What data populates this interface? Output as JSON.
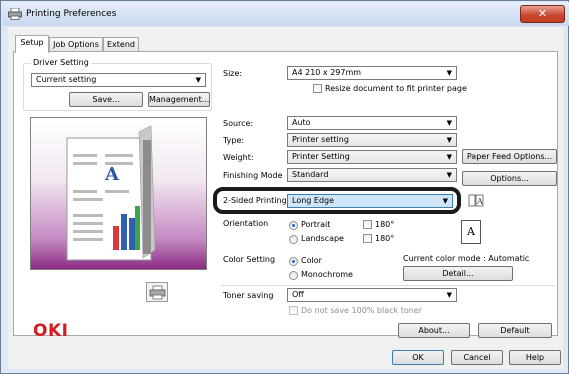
{
  "window": {
    "title": "Printing Preferences",
    "close_symbol": "✕"
  },
  "tabs": [
    {
      "label": "Setup",
      "active": true
    },
    {
      "label": "Job Options",
      "active": false
    },
    {
      "label": "Extend",
      "active": false
    }
  ],
  "driver_setting": {
    "group_label": "Driver Setting",
    "value": "Current setting",
    "save_label": "Save...",
    "management_label": "Management..."
  },
  "paper": {
    "size_label": "Size:",
    "size_value": "A4 210 x 297mm",
    "resize_label": "Resize document to fit printer page",
    "source_label": "Source:",
    "source_value": "Auto",
    "type_label": "Type:",
    "type_value": "Printer setting",
    "weight_label": "Weight:",
    "weight_value": "Printer Setting",
    "paper_feed_label": "Paper Feed Options...",
    "finishing_label": "Finishing Mode",
    "finishing_value": "Standard",
    "options_label": "Options..."
  },
  "two_sided": {
    "label": "2-Sided Printing",
    "value": "Long Edge"
  },
  "orientation": {
    "label": "Orientation",
    "portrait": "Portrait",
    "landscape": "Landscape",
    "rotate1": "180°",
    "rotate2": "180°",
    "selected": "portrait",
    "page_glyph": "A"
  },
  "color": {
    "label": "Color Setting",
    "color_option": "Color",
    "mono_option": "Monochrome",
    "mode_text": "Current color mode : Automatic",
    "detail_label": "Detail..."
  },
  "toner": {
    "label": "Toner saving",
    "value": "Off",
    "no_save_label": "Do not save 100% black toner"
  },
  "preview": {
    "page_glyph": "A"
  },
  "brand": {
    "logo": "OKI",
    "color": "#d11d1d"
  },
  "footer": {
    "about_label": "About...",
    "default_label": "Default",
    "ok_label": "OK",
    "cancel_label": "Cancel",
    "help_label": "Help"
  },
  "colors": {
    "accent": "#3c7fb1",
    "preview_purple": "#8b2b83",
    "close": "#c7442b"
  }
}
